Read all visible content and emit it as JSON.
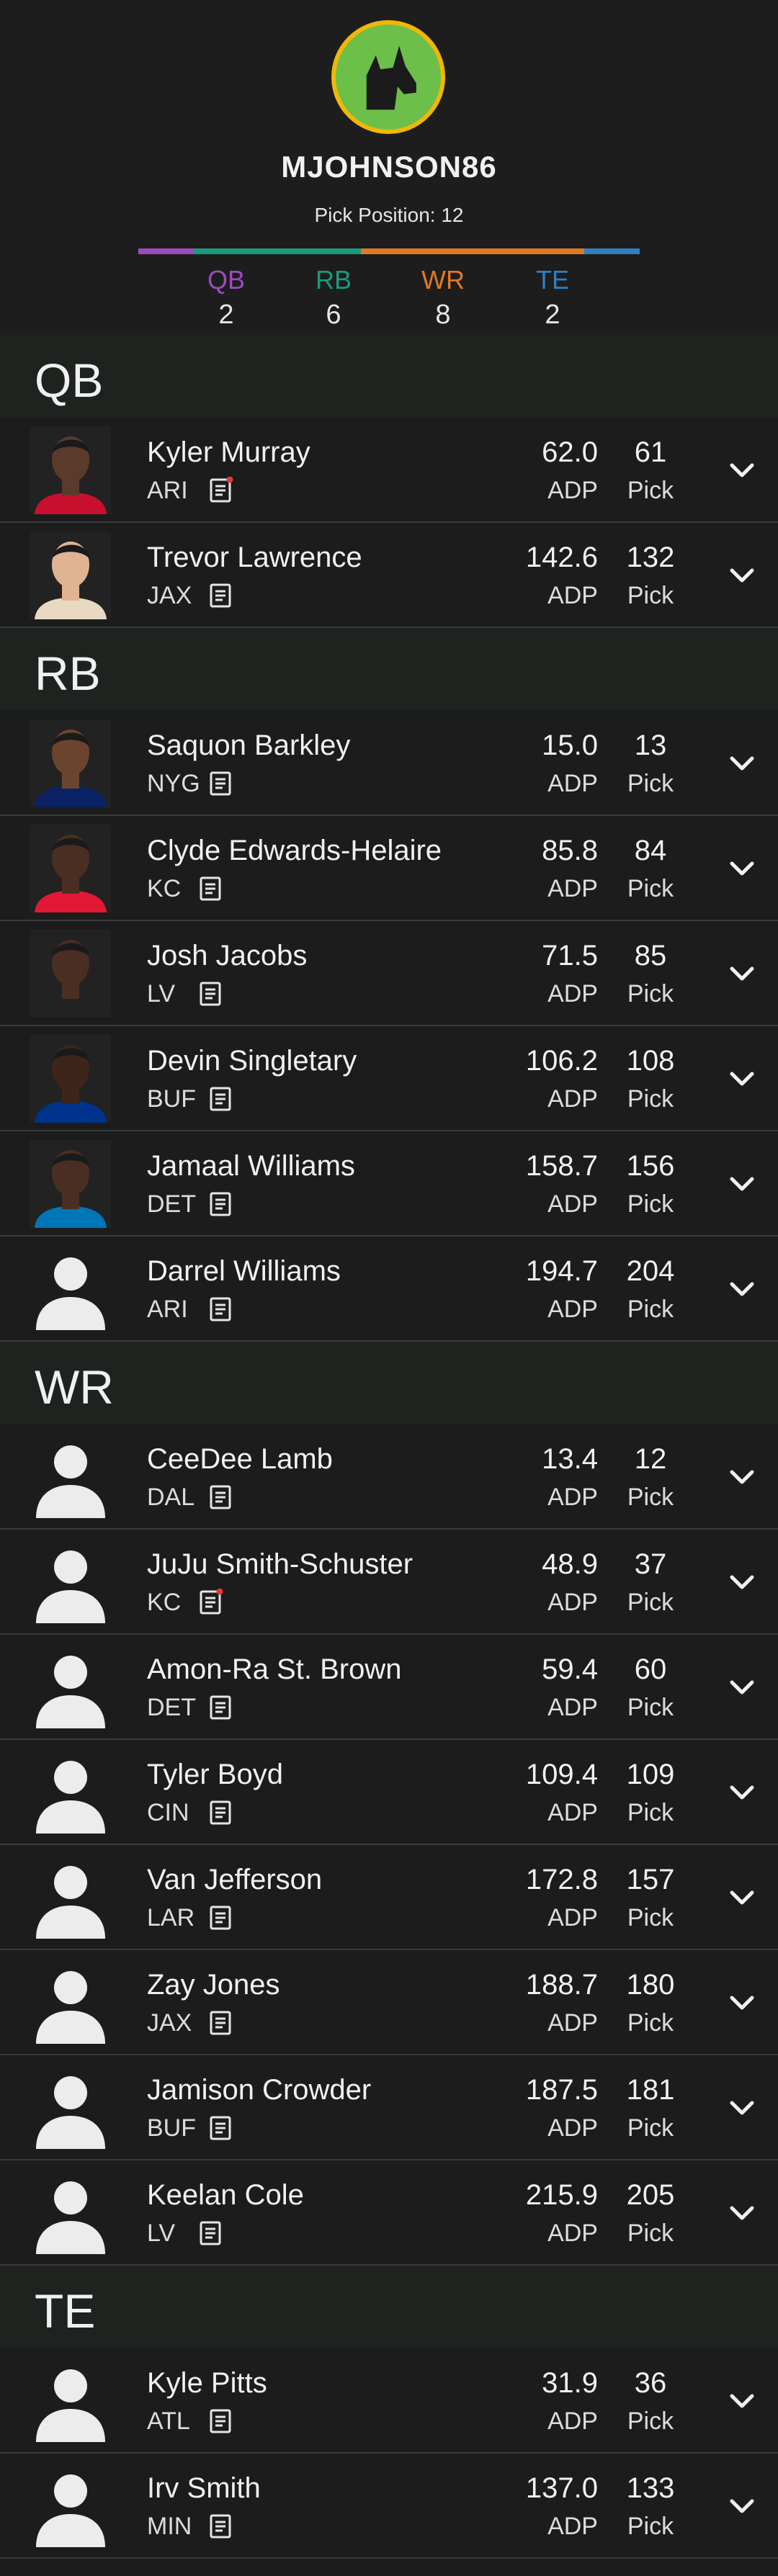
{
  "header": {
    "username": "MJOHNSON86",
    "pick_position": "Pick Position: 12",
    "avatar_icon": "dog-head-icon",
    "colors": {
      "qb": "#9d4bbf",
      "rb": "#1a9a7c",
      "wr": "#e07a22",
      "te": "#2f7fc1",
      "avatar_bg": "#6cc04a",
      "avatar_ring": "#f2b705"
    },
    "bar": {
      "qb": 2,
      "rb": 6,
      "wr": 8,
      "te": 2
    },
    "positions": [
      {
        "label": "QB",
        "count": "2"
      },
      {
        "label": "RB",
        "count": "6"
      },
      {
        "label": "WR",
        "count": "8"
      },
      {
        "label": "TE",
        "count": "2"
      }
    ]
  },
  "labels": {
    "adp": "ADP",
    "pick": "Pick"
  },
  "icons": {
    "note": "note-icon",
    "expand": "chevron-down-icon",
    "placeholder": "person-silhouette-icon"
  },
  "sections": [
    {
      "title": "QB",
      "players": [
        {
          "name": "Kyler Murray",
          "team": "ARI",
          "adp": "62.0",
          "pick": "61",
          "photo": true,
          "note_dot": true,
          "jersey": "#c8102e",
          "skin": "#5a3a2a"
        },
        {
          "name": "Trevor Lawrence",
          "team": "JAX",
          "adp": "142.6",
          "pick": "132",
          "photo": true,
          "note_dot": false,
          "jersey": "#e8d9c2",
          "skin": "#e0b392"
        }
      ]
    },
    {
      "title": "RB",
      "players": [
        {
          "name": "Saquon Barkley",
          "team": "NYG",
          "adp": "15.0",
          "pick": "13",
          "photo": true,
          "note_dot": false,
          "jersey": "#0b2265",
          "skin": "#6b4430"
        },
        {
          "name": "Clyde Edwards-Helaire",
          "team": "KC",
          "adp": "85.8",
          "pick": "84",
          "photo": true,
          "note_dot": false,
          "jersey": "#e31837",
          "skin": "#4a2e22"
        },
        {
          "name": "Josh Jacobs",
          "team": "LV",
          "adp": "71.5",
          "pick": "85",
          "photo": true,
          "note_dot": false,
          "jersey": "#222222",
          "skin": "#4a2e22"
        },
        {
          "name": "Devin Singletary",
          "team": "BUF",
          "adp": "106.2",
          "pick": "108",
          "photo": true,
          "note_dot": false,
          "jersey": "#00338d",
          "skin": "#3e2519"
        },
        {
          "name": "Jamaal Williams",
          "team": "DET",
          "adp": "158.7",
          "pick": "156",
          "photo": true,
          "note_dot": false,
          "jersey": "#0076b6",
          "skin": "#4a2e22"
        },
        {
          "name": "Darrel Williams",
          "team": "ARI",
          "adp": "194.7",
          "pick": "204",
          "photo": false,
          "note_dot": false
        }
      ]
    },
    {
      "title": "WR",
      "players": [
        {
          "name": "CeeDee Lamb",
          "team": "DAL",
          "adp": "13.4",
          "pick": "12",
          "photo": false,
          "note_dot": false
        },
        {
          "name": "JuJu Smith-Schuster",
          "team": "KC",
          "adp": "48.9",
          "pick": "37",
          "photo": false,
          "note_dot": true
        },
        {
          "name": "Amon-Ra St. Brown",
          "team": "DET",
          "adp": "59.4",
          "pick": "60",
          "photo": false,
          "note_dot": false
        },
        {
          "name": "Tyler Boyd",
          "team": "CIN",
          "adp": "109.4",
          "pick": "109",
          "photo": false,
          "note_dot": false
        },
        {
          "name": "Van Jefferson",
          "team": "LAR",
          "adp": "172.8",
          "pick": "157",
          "photo": false,
          "note_dot": false
        },
        {
          "name": "Zay Jones",
          "team": "JAX",
          "adp": "188.7",
          "pick": "180",
          "photo": false,
          "note_dot": false
        },
        {
          "name": "Jamison Crowder",
          "team": "BUF",
          "adp": "187.5",
          "pick": "181",
          "photo": false,
          "note_dot": false
        },
        {
          "name": "Keelan Cole",
          "team": "LV",
          "adp": "215.9",
          "pick": "205",
          "photo": false,
          "note_dot": false
        }
      ]
    },
    {
      "title": "TE",
      "players": [
        {
          "name": "Kyle Pitts",
          "team": "ATL",
          "adp": "31.9",
          "pick": "36",
          "photo": false,
          "note_dot": false
        },
        {
          "name": "Irv Smith",
          "team": "MIN",
          "adp": "137.0",
          "pick": "133",
          "photo": false,
          "note_dot": false
        }
      ]
    }
  ]
}
